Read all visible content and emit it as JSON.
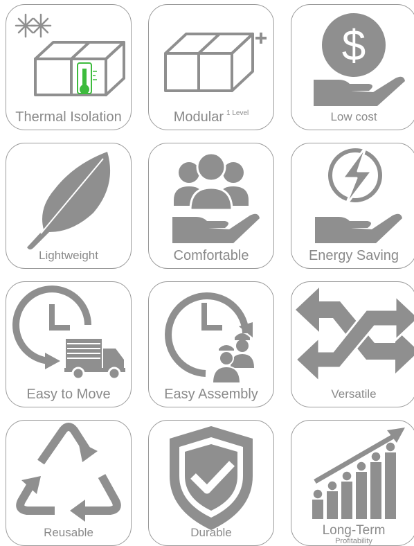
{
  "features": [
    {
      "label": "Thermal Isolation",
      "icon": "thermal-box-icon"
    },
    {
      "label": "Modular",
      "sup": "1 Level",
      "icon": "modular-box-icon"
    },
    {
      "label": "Low cost",
      "icon": "dollar-hand-icon"
    },
    {
      "label": "Lightweight",
      "icon": "feather-icon"
    },
    {
      "label": "Comfortable",
      "icon": "people-hand-icon"
    },
    {
      "label": "Energy Saving",
      "icon": "energy-hand-icon"
    },
    {
      "label": "Easy to Move",
      "icon": "clock-truck-icon"
    },
    {
      "label": "Easy Assembly",
      "icon": "clock-workers-icon"
    },
    {
      "label": "Versatile",
      "icon": "crossed-arrows-icon"
    },
    {
      "label": "Reusable",
      "icon": "recycle-icon"
    },
    {
      "label": "Durable",
      "icon": "shield-check-icon"
    },
    {
      "label": "Long-Term",
      "sub": "Profitability",
      "icon": "growth-chart-icon"
    }
  ],
  "colors": {
    "icon": "#8f8f8f",
    "accent": "#3dbb3d",
    "border": "#9a9a9a",
    "text": "#8a8a8a"
  }
}
